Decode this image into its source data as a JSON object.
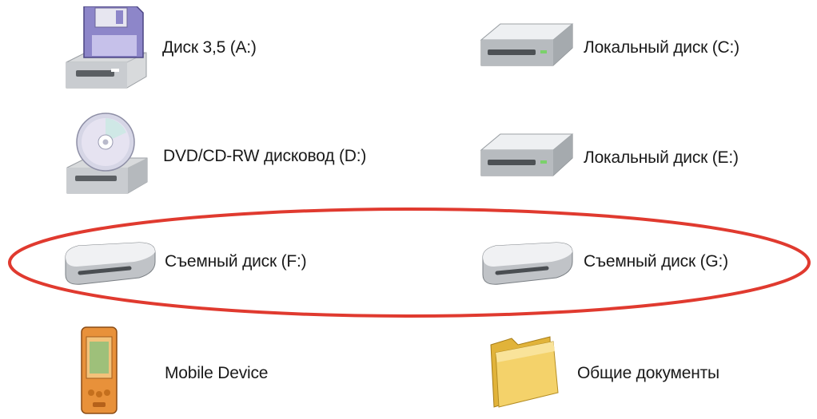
{
  "drives": [
    {
      "label": "Диск 3,5 (A:)",
      "icon": "floppy-drive-icon"
    },
    {
      "label": "Локальный диск (C:)",
      "icon": "hard-disk-icon"
    },
    {
      "label": "DVD/CD-RW дисковод (D:)",
      "icon": "dvd-drive-icon"
    },
    {
      "label": "Локальный диск (E:)",
      "icon": "hard-disk-icon"
    },
    {
      "label": "Съемный диск (F:)",
      "icon": "removable-disk-icon"
    },
    {
      "label": "Съемный диск (G:)",
      "icon": "removable-disk-icon"
    },
    {
      "label": "Mobile Device",
      "icon": "pda-icon"
    },
    {
      "label": "Общие документы",
      "icon": "folder-icon"
    }
  ],
  "colors": {
    "highlight": "#e03a2f",
    "folder": "#f4c542",
    "pda_screen": "#f3a53c"
  }
}
